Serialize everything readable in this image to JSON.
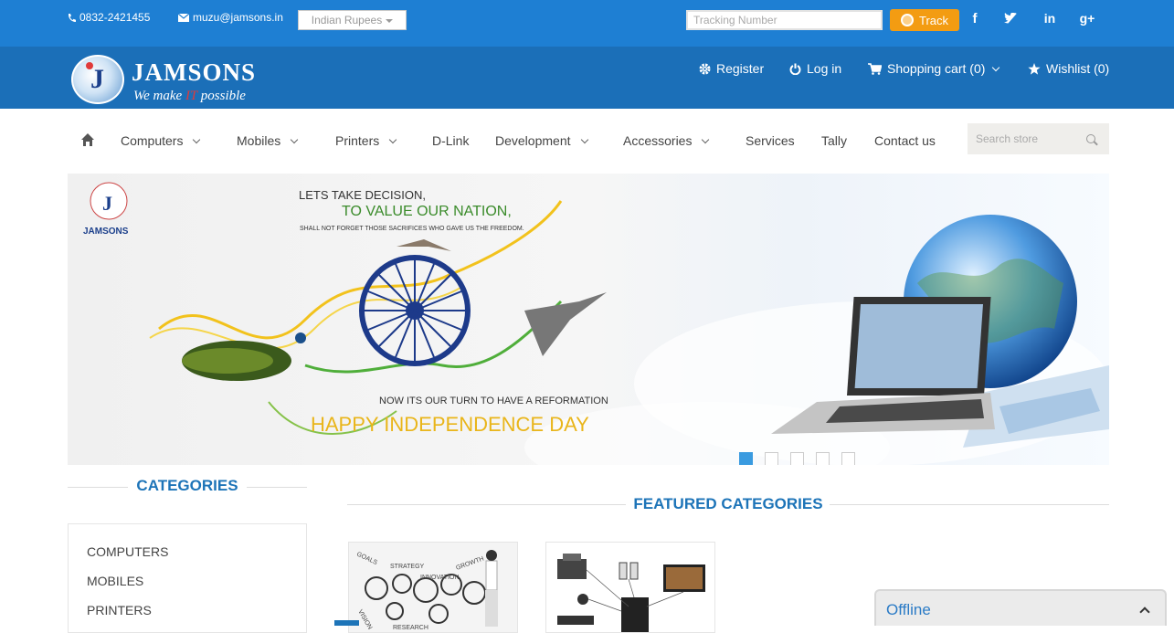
{
  "topbar": {
    "phone": "0832-2421455",
    "email": "muzu@jamsons.in",
    "currency": "Indian Rupees",
    "tracking_placeholder": "Tracking Number",
    "track_label": "Track",
    "social": [
      "f",
      "t",
      "in",
      "g+"
    ]
  },
  "header": {
    "logo_name": "JAMSONS",
    "logo_tag_pre": "We make ",
    "logo_tag_it": "IT",
    "logo_tag_post": " possible",
    "register": "Register",
    "login": "Log in",
    "cart": "Shopping cart (0)",
    "wishlist": "Wishlist (0)"
  },
  "nav": {
    "items": [
      "Computers",
      "Mobiles",
      "Printers",
      "D-Link",
      "Development",
      "Accessories",
      "Services",
      "Tally",
      "Contact us"
    ],
    "search_placeholder": "Search store"
  },
  "banner": {
    "line1": "LETS TAKE DECISION,",
    "line2": "TO VALUE OUR NATION,",
    "line3": "SHALL NOT FORGET THOSE SACRIFICES WHO GAVE US THE FREEDOM.",
    "line4": "NOW ITS OUR TURN TO HAVE A REFORMATION",
    "line5": "HAPPY INDEPENDENCE DAY",
    "mini_logo": "JAMSONS",
    "slide_count": 5,
    "active_slide": 1
  },
  "categories": {
    "title": "CATEGORIES",
    "items": [
      "COMPUTERS",
      "MOBILES",
      "PRINTERS"
    ]
  },
  "featured": {
    "title": "FEATURED CATEGORIES"
  },
  "chat": {
    "status": "Offline"
  },
  "colors": {
    "topbar": "#1e7fd3",
    "header": "#1b6fb8",
    "accent": "#1d74b8",
    "track": "#f39c12"
  }
}
